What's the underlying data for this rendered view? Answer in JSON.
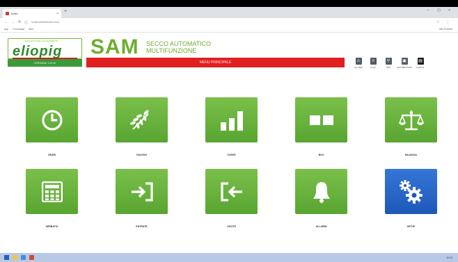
{
  "browser": {
    "tab_title": "Index",
    "tab_close": "×",
    "new_tab": "+",
    "window_controls": "– ▢ ×",
    "url": "localhost/SAM/menu.html",
    "bookmarks": [
      "App",
      "Cronologia",
      "Altro"
    ],
    "bookmarks_right": "Altri Preferiti"
  },
  "header": {
    "logo_tag": "PROGETTI PER L'ALLEVAMENTO",
    "logo_text": "eliopig",
    "version": "VERSIONE 1.00.00",
    "sam_title": "SAM",
    "sam_sub1": "SECCO AUTOMATICO",
    "sam_sub2": "MULTIFUNZIONE",
    "menu_title": "MENU PRINCIPALE"
  },
  "tools": [
    {
      "label": "ALLARMI",
      "icon": "alarm-triangle-icon",
      "color": "#505a64"
    },
    {
      "label": "LOGS",
      "icon": "log-document-icon",
      "color": "#505a64"
    },
    {
      "label": "TRIP",
      "icon": "search-icon",
      "color": "#505a64"
    },
    {
      "label": "DISTRIBUZIONE",
      "icon": "camera-icon",
      "color": "#505a64"
    },
    {
      "label": "MANUAL",
      "icon": "manual-book-icon",
      "color": "#1e1e1e"
    }
  ],
  "tiles": [
    {
      "label": "ORARI",
      "icon": "clock-icon"
    },
    {
      "label": "RAZIONI",
      "icon": "wheat-icon"
    },
    {
      "label": "CURVE",
      "icon": "bar-chart-icon"
    },
    {
      "label": "BOX",
      "icon": "boxes-icon"
    },
    {
      "label": "BILANCIA",
      "icon": "scale-icon"
    },
    {
      "label": "SERBATOI",
      "icon": "calculator-icon"
    },
    {
      "label": "ENTRATE",
      "icon": "enter-icon"
    },
    {
      "label": "USCITE",
      "icon": "exit-icon"
    },
    {
      "label": "ALLARMI",
      "icon": "bell-icon"
    },
    {
      "label": "SETUP",
      "icon": "gears-icon"
    }
  ],
  "taskbar": {
    "clock": "10:24"
  },
  "colors": {
    "brand_green": "#6cae2e",
    "tile_green": "#58a531",
    "menu_red": "#e02020",
    "tile_blue": "#1d58b9"
  }
}
